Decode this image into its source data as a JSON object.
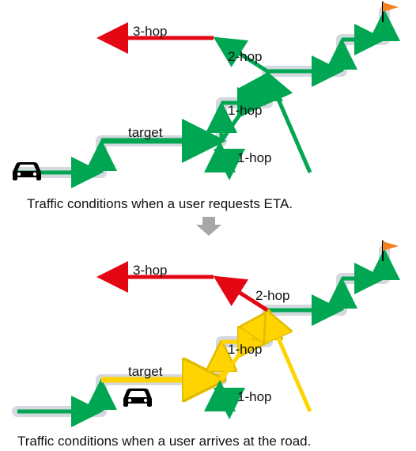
{
  "colors": {
    "green": "#00a651",
    "greenStroke": "#009a4a",
    "red": "#e30613",
    "yellow": "#ffd400",
    "yellowStroke": "#f2c200",
    "shadow": "#d4d8df",
    "flag": "#f58220",
    "arrowGrey": "#a7a7a7"
  },
  "captions": {
    "top": "Traffic conditions when a user requests ETA.",
    "bottom": "Traffic conditions when a user arrives at the road."
  },
  "labels": {
    "target": "target",
    "hop1": "1-hop",
    "hop2": "2-hop",
    "hop3": "3-hop"
  },
  "icons": {
    "car": "car-icon",
    "flag": "flag-icon",
    "downArrow": "down-arrow-icon"
  }
}
